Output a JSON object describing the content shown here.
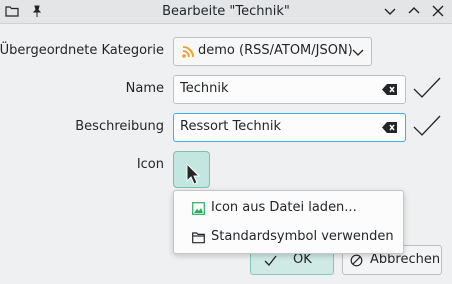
{
  "window": {
    "title": "Bearbeite \"Technik\""
  },
  "form": {
    "parent_label": "Übergeordnete Kategorie",
    "parent_value": "demo (RSS/ATOM/JSON)",
    "name_label": "Name",
    "name_value": "Technik",
    "desc_label": "Beschreibung",
    "desc_value": "Ressort Technik",
    "icon_label": "Icon"
  },
  "menu": {
    "items": [
      {
        "label": "Icon aus Datei laden...",
        "icon": "image-icon"
      },
      {
        "label": "Standardsymbol verwenden",
        "icon": "folder-icon"
      }
    ]
  },
  "buttons": {
    "ok": "OK",
    "cancel": "Abbrechen"
  },
  "colors": {
    "accent": "#3daee9",
    "rss": "#f39c1f",
    "ok_bg": "#cfeae4"
  }
}
